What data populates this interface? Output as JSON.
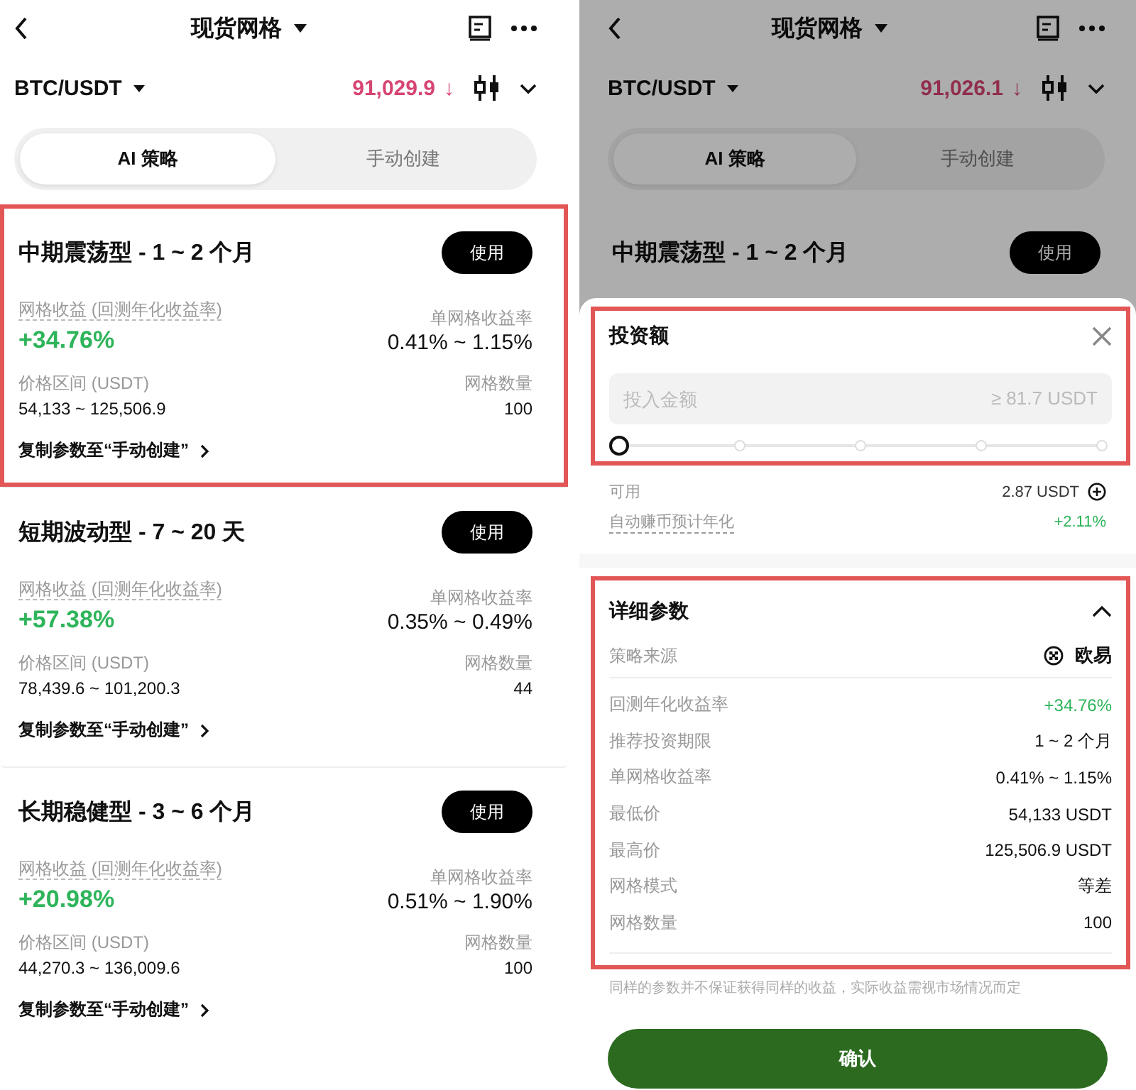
{
  "screens": [
    {
      "header": {
        "title": "现货网格"
      },
      "pair": "BTC/USDT",
      "price": "91,029.9",
      "price_arrow": "↓",
      "tabs": [
        {
          "label": "AI 策略",
          "selected": true
        },
        {
          "label": "手动创建",
          "selected": false
        }
      ],
      "strategies": [
        {
          "title": "中期震荡型 - 1 ~ 2 个月",
          "use_button": "使用",
          "highlighted": true,
          "yield_label": "网格收益 (回测年化收益率)",
          "yield": "+34.76%",
          "rate_label": "单网格收益率",
          "rate": "0.41% ~ 1.15%",
          "range_label": "价格区间 (USDT)",
          "range": "54,133 ~ 125,506.9",
          "count_label": "网格数量",
          "count": "100",
          "copy_link": "复制参数至“手动创建”"
        },
        {
          "title": "短期波动型 - 7 ~ 20 天",
          "use_button": "使用",
          "highlighted": false,
          "yield_label": "网格收益 (回测年化收益率)",
          "yield": "+57.38%",
          "rate_label": "单网格收益率",
          "rate": "0.35% ~ 0.49%",
          "range_label": "价格区间 (USDT)",
          "range": "78,439.6 ~ 101,200.3",
          "count_label": "网格数量",
          "count": "44",
          "copy_link": "复制参数至“手动创建”"
        },
        {
          "title": "长期稳健型 - 3 ~ 6 个月",
          "use_button": "使用",
          "highlighted": false,
          "yield_label": "网格收益 (回测年化收益率)",
          "yield": "+20.98%",
          "rate_label": "单网格收益率",
          "rate": "0.51% ~ 1.90%",
          "range_label": "价格区间 (USDT)",
          "range": "44,270.3 ~ 136,009.6",
          "count_label": "网格数量",
          "count": "100",
          "copy_link": "复制参数至“手动创建”"
        }
      ]
    },
    {
      "header": {
        "title": "现货网格"
      },
      "pair": "BTC/USDT",
      "price": "91,026.1",
      "price_arrow": "↓",
      "tabs": [
        {
          "label": "AI 策略",
          "selected": true
        },
        {
          "label": "手动创建",
          "selected": false
        }
      ],
      "strategies": [
        {
          "title": "中期震荡型 - 1 ~ 2 个月",
          "use_button": "使用",
          "highlighted": false
        }
      ],
      "sheet": {
        "investment": {
          "title": "投资额",
          "highlighted": true,
          "placeholder": "投入金额",
          "minimum": "≥ 81.7 USDT",
          "level": 0,
          "available_label": "可用",
          "available": "2.87 USDT",
          "auto_earn_label": "自动赚币预计年化",
          "auto_earn": "+2.11%"
        },
        "details": {
          "title": "详细参数",
          "highlighted": true,
          "expanded": true,
          "source_label": "策略来源",
          "source": "欧易",
          "params": [
            {
              "label": "回测年化收益率",
              "value": "+34.76%",
              "kind": "positive"
            },
            {
              "label": "推荐投资期限",
              "value": "1 ~ 2 个月",
              "kind": "plain"
            },
            {
              "label": "单网格收益率",
              "value": "0.41% ~ 1.15%",
              "kind": "plain"
            },
            {
              "label": "最低价",
              "value": "54,133 USDT",
              "kind": "plain"
            },
            {
              "label": "最高价",
              "value": "125,506.9 USDT",
              "kind": "plain"
            },
            {
              "label": "网格模式",
              "value": "等差",
              "kind": "plain"
            },
            {
              "label": "网格数量",
              "value": "100",
              "kind": "plain"
            }
          ]
        },
        "disclaimer": "同样的参数并不保证获得同样的收益，实际收益需视市场情况而定",
        "confirm_button": "确认"
      }
    }
  ]
}
